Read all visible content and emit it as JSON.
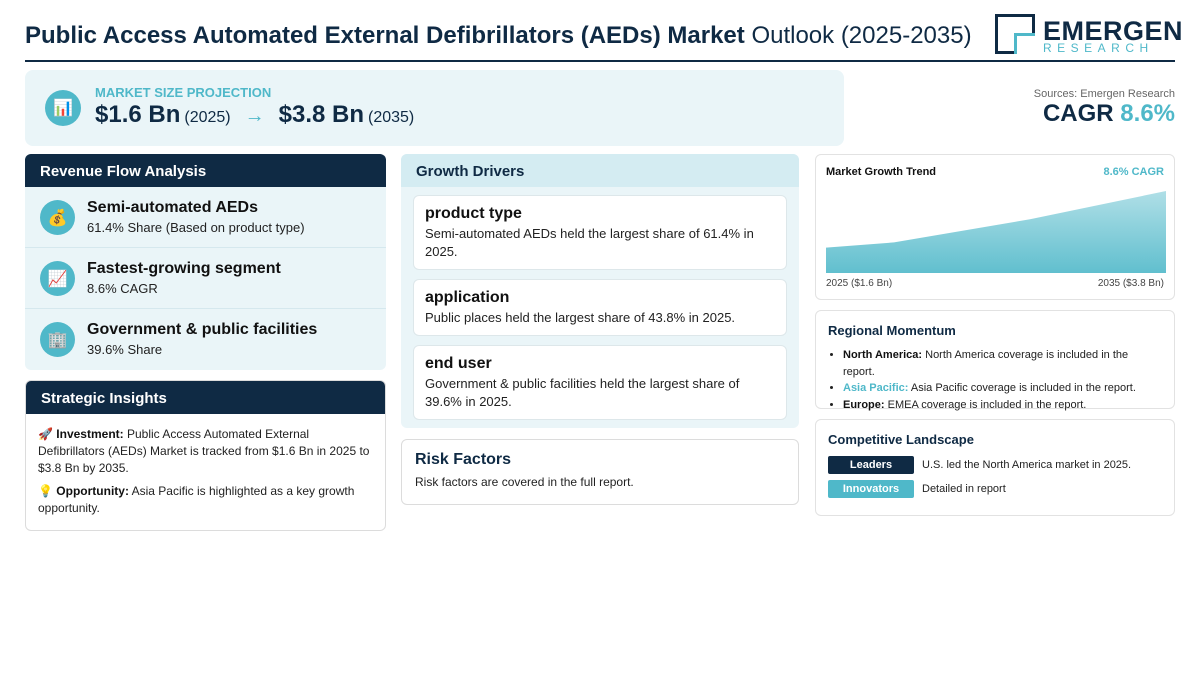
{
  "header": {
    "title_bold": "Public Access Automated External Defibrillators (AEDs) Market",
    "title_light": "Outlook (2025-2035)",
    "logo_name": "EMERGEN",
    "logo_sub": "RESEARCH"
  },
  "market_size": {
    "label": "MARKET SIZE PROJECTION",
    "icon": "bar-chart-icon",
    "start_value": "$1.6 Bn",
    "start_year": "(2025)",
    "arrow": "→",
    "end_value": "$3.8 Bn",
    "end_year": "(2035)"
  },
  "cagr": {
    "source": "Sources: Emergen Research",
    "label": "CAGR",
    "value": "8.6%"
  },
  "revenue": {
    "title": "Revenue Flow Analysis",
    "items": [
      {
        "icon": "money-bag-icon",
        "glyph": "💰",
        "title": "Semi-automated AEDs",
        "sub": "61.4% Share (Based on product type)"
      },
      {
        "icon": "trend-up-icon",
        "glyph": "📈",
        "title": "Fastest-growing segment",
        "sub": "8.6% CAGR"
      },
      {
        "icon": "building-icon",
        "glyph": "🏢",
        "title": "Government & public facilities",
        "sub": "39.6% Share"
      }
    ]
  },
  "insights": {
    "title": "Strategic Insights",
    "investment_icon": "🚀",
    "investment_label": "Investment:",
    "investment_text": "Public Access Automated External Defibrillators (AEDs) Market is tracked from $1.6 Bn in 2025 to $3.8 Bn by 2035.",
    "opportunity_icon": "💡",
    "opportunity_label": "Opportunity:",
    "opportunity_text": "Asia Pacific is highlighted as a key growth opportunity."
  },
  "drivers": {
    "title": "Growth Drivers",
    "items": [
      {
        "title": "product type",
        "desc": "Semi-automated AEDs held the largest share of 61.4% in 2025."
      },
      {
        "title": "application",
        "desc": "Public places held the largest share of 43.8% in 2025."
      },
      {
        "title": "end user",
        "desc": "Government & public facilities held the largest share of 39.6% in 2025."
      }
    ]
  },
  "risk": {
    "title": "Risk Factors",
    "desc": "Risk factors are covered in the full report."
  },
  "trend": {
    "title": "Market Growth Trend",
    "cagr_label": "8.6% CAGR",
    "start_label": "2025 ($1.6 Bn)",
    "end_label": "2035 ($3.8 Bn)"
  },
  "chart_data": {
    "type": "area",
    "x": [
      2025,
      2027,
      2031,
      2035
    ],
    "y": [
      1.6,
      1.8,
      2.7,
      3.8
    ],
    "xlabel": "",
    "ylabel": "",
    "grid": false,
    "fill_color": "#4fb8c9"
  },
  "regional": {
    "title": "Regional Momentum",
    "items": [
      {
        "region": "North America:",
        "text": "North America coverage is included in the report."
      },
      {
        "region": "Asia Pacific:",
        "text": "Asia Pacific coverage is included in the report."
      },
      {
        "region": "Europe:",
        "text": "EMEA coverage is included in the report."
      }
    ]
  },
  "competitive": {
    "title": "Competitive Landscape",
    "rows": [
      {
        "badge": "Leaders",
        "text": "U.S. led the North America market in 2025."
      },
      {
        "badge": "Innovators",
        "text": "Detailed in report"
      }
    ]
  },
  "colors": {
    "navy": "#0f2a44",
    "teal": "#4fb8c9",
    "panel": "#eaf5f8"
  }
}
